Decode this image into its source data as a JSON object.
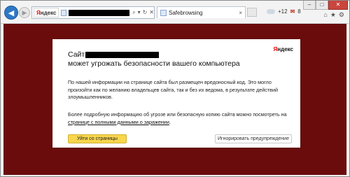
{
  "browser": {
    "yandex_badge": "Яндекс",
    "yandex_badge_y": "Я",
    "yandex_badge_rest": "ндекс",
    "addr_icons": [
      "⌕",
      "▾",
      "↻",
      "✕"
    ],
    "tab": {
      "title": "Safebrowsing",
      "close": "×"
    },
    "weather": "+12",
    "mail_count": "8",
    "window_controls": {
      "minimize": "–",
      "maximize": "□",
      "close": "✕"
    },
    "right_icons": [
      "⌂",
      "★",
      "⚙"
    ]
  },
  "warning": {
    "logo_y": "Я",
    "logo_rest": "ндекс",
    "title_prefix": "Сайт",
    "title_line2": "может угрожать безопасности вашего компьютера",
    "paragraph1": "По нашей информации на странице сайта был размещен вредоносный код. Это могло произойти как по желанию владельцев сайта, так и без их ведома, в результате действий злоумышленников.",
    "paragraph2_prefix": "Более подробную информацию об угрозе или безопасную копию сайта можно посмотреть на ",
    "paragraph2_link": "странице с полными данными о заражении",
    "paragraph2_suffix": ".",
    "leave_button": "Уйти со страницы",
    "ignore_button": "Игнорировать предупреждение"
  },
  "colors": {
    "background": "#6b0c0c",
    "leave_button": "#f8d64c",
    "yandex_red": "#e20000"
  }
}
